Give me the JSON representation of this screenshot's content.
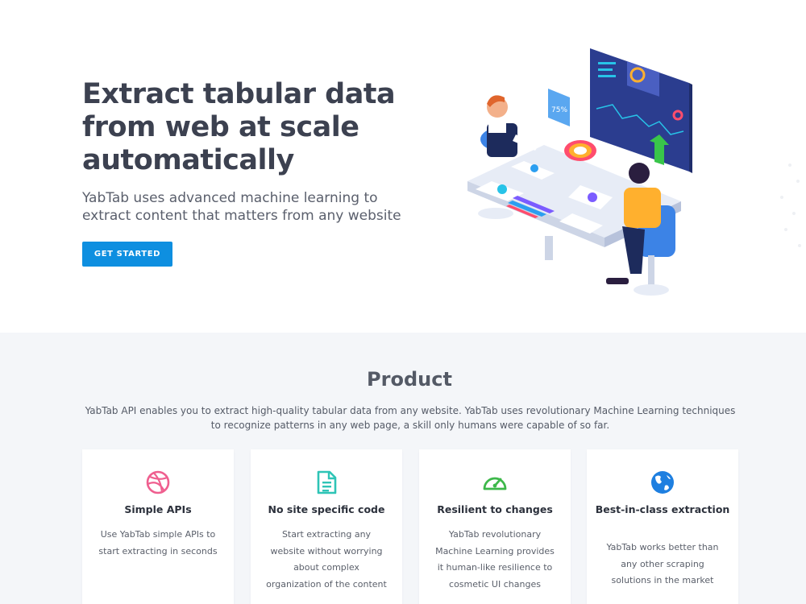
{
  "hero": {
    "title": "Extract tabular data from web at scale automatically",
    "subtitle": "YabTab uses advanced machine learning to extract content that matters from any website",
    "cta_label": "GET STARTED",
    "illustration_percent": "75%",
    "accent_color": "#0e8fe0"
  },
  "product": {
    "title": "Product",
    "description": "YabTab API enables you to extract high-quality tabular data from any website. YabTab uses revolutionary Machine Learning techniques to recognize patterns in any web page, a skill only humans were capable of so far.",
    "features": [
      {
        "icon": "dribbble-icon",
        "title": "Simple APIs",
        "description": "Use YabTab simple APIs to start extracting in seconds"
      },
      {
        "icon": "document-icon",
        "title": "No site specific code",
        "description": "Start extracting any website without worrying about complex organization of the content"
      },
      {
        "icon": "speedometer-icon",
        "title": "Resilient to changes",
        "description": "YabTab revolutionary Machine Learning provides it human-like resilience to cosmetic UI changes"
      },
      {
        "icon": "globe-icon",
        "title": "Best-in-class extraction",
        "description": "YabTab works better than any other scraping solutions in the market"
      }
    ]
  }
}
